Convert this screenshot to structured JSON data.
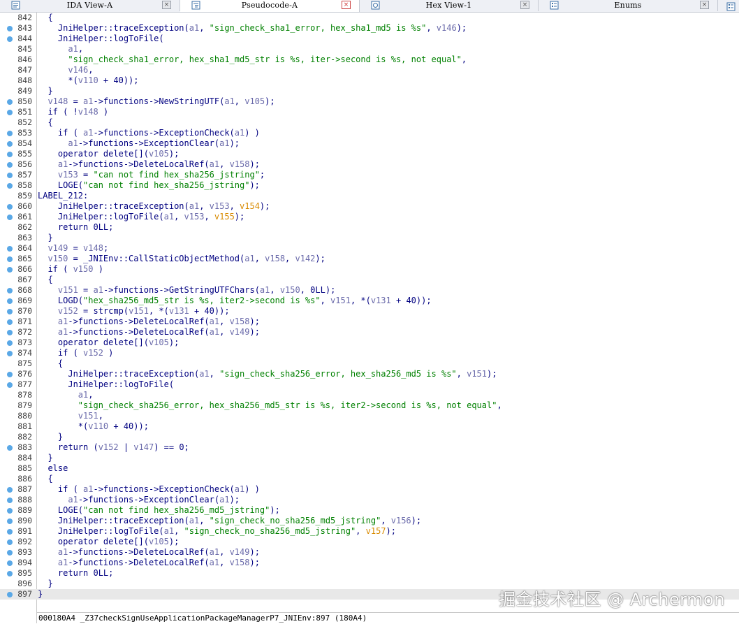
{
  "tabs": [
    {
      "label": "IDA View-A",
      "icon": "ida-view-icon",
      "active": false
    },
    {
      "label": "Pseudocode-A",
      "icon": "pseudocode-icon",
      "active": true
    },
    {
      "label": "Hex View-1",
      "icon": "hex-view-icon",
      "active": false
    },
    {
      "label": "Enums",
      "icon": "enums-icon",
      "active": false
    }
  ],
  "code_lines": [
    {
      "n": "842",
      "dot": false,
      "cur": false,
      "tokens": [
        [
          "  {",
          "t"
        ]
      ]
    },
    {
      "n": "843",
      "dot": true,
      "cur": false,
      "tokens": [
        [
          "    JniHelper::traceException(",
          "t"
        ],
        [
          "a1",
          "v"
        ],
        [
          ", ",
          "t"
        ],
        [
          "\"sign_check_sha1_error, hex_sha1_md5 is %s\"",
          "s"
        ],
        [
          ", ",
          "t"
        ],
        [
          "v146",
          "v"
        ],
        [
          ");",
          "t"
        ]
      ]
    },
    {
      "n": "844",
      "dot": true,
      "cur": false,
      "tokens": [
        [
          "    JniHelper::logToFile(",
          "t"
        ]
      ]
    },
    {
      "n": "845",
      "dot": false,
      "cur": false,
      "tokens": [
        [
          "      ",
          "t"
        ],
        [
          "a1",
          "v"
        ],
        [
          ",",
          "t"
        ]
      ]
    },
    {
      "n": "846",
      "dot": false,
      "cur": false,
      "tokens": [
        [
          "      ",
          "t"
        ],
        [
          "\"sign_check_sha1_error, hex_sha1_md5_str is %s, iter->second is %s, not equal\"",
          "s"
        ],
        [
          ",",
          "t"
        ]
      ]
    },
    {
      "n": "847",
      "dot": false,
      "cur": false,
      "tokens": [
        [
          "      ",
          "t"
        ],
        [
          "v146",
          "v"
        ],
        [
          ",",
          "t"
        ]
      ]
    },
    {
      "n": "848",
      "dot": false,
      "cur": false,
      "tokens": [
        [
          "      *(",
          "t"
        ],
        [
          "v110",
          "v"
        ],
        [
          " + 40));",
          "t"
        ]
      ]
    },
    {
      "n": "849",
      "dot": false,
      "cur": false,
      "tokens": [
        [
          "  }",
          "t"
        ]
      ]
    },
    {
      "n": "850",
      "dot": true,
      "cur": false,
      "tokens": [
        [
          "  ",
          "t"
        ],
        [
          "v148",
          "v"
        ],
        [
          " = ",
          "t"
        ],
        [
          "a1",
          "v"
        ],
        [
          "->functions->NewStringUTF(",
          "t"
        ],
        [
          "a1",
          "v"
        ],
        [
          ", ",
          "t"
        ],
        [
          "v105",
          "v"
        ],
        [
          ");",
          "t"
        ]
      ]
    },
    {
      "n": "851",
      "dot": true,
      "cur": false,
      "tokens": [
        [
          "  if ( !",
          "t"
        ],
        [
          "v148",
          "v"
        ],
        [
          " )",
          "t"
        ]
      ]
    },
    {
      "n": "852",
      "dot": false,
      "cur": false,
      "tokens": [
        [
          "  {",
          "t"
        ]
      ]
    },
    {
      "n": "853",
      "dot": true,
      "cur": false,
      "tokens": [
        [
          "    if ( ",
          "t"
        ],
        [
          "a1",
          "v"
        ],
        [
          "->functions->ExceptionCheck(",
          "t"
        ],
        [
          "a1",
          "v"
        ],
        [
          ") )",
          "t"
        ]
      ]
    },
    {
      "n": "854",
      "dot": true,
      "cur": false,
      "tokens": [
        [
          "      ",
          "t"
        ],
        [
          "a1",
          "v"
        ],
        [
          "->functions->ExceptionClear(",
          "t"
        ],
        [
          "a1",
          "v"
        ],
        [
          ");",
          "t"
        ]
      ]
    },
    {
      "n": "855",
      "dot": true,
      "cur": false,
      "tokens": [
        [
          "    operator delete[](",
          "t"
        ],
        [
          "v105",
          "v"
        ],
        [
          ");",
          "t"
        ]
      ]
    },
    {
      "n": "856",
      "dot": true,
      "cur": false,
      "tokens": [
        [
          "    ",
          "t"
        ],
        [
          "a1",
          "v"
        ],
        [
          "->functions->DeleteLocalRef(",
          "t"
        ],
        [
          "a1",
          "v"
        ],
        [
          ", ",
          "t"
        ],
        [
          "v158",
          "v"
        ],
        [
          ");",
          "t"
        ]
      ]
    },
    {
      "n": "857",
      "dot": true,
      "cur": false,
      "tokens": [
        [
          "    ",
          "t"
        ],
        [
          "v153",
          "v"
        ],
        [
          " = ",
          "t"
        ],
        [
          "\"can not find hex_sha256_jstring\"",
          "s"
        ],
        [
          ";",
          "t"
        ]
      ]
    },
    {
      "n": "858",
      "dot": true,
      "cur": false,
      "tokens": [
        [
          "    LOGE(",
          "t"
        ],
        [
          "\"can not find hex_sha256_jstring\"",
          "s"
        ],
        [
          ");",
          "t"
        ]
      ]
    },
    {
      "n": "859",
      "dot": false,
      "cur": false,
      "tokens": [
        [
          "LABEL_212:",
          "t"
        ]
      ]
    },
    {
      "n": "860",
      "dot": true,
      "cur": false,
      "tokens": [
        [
          "    JniHelper::traceException(",
          "t"
        ],
        [
          "a1",
          "v"
        ],
        [
          ", ",
          "t"
        ],
        [
          "v153",
          "v"
        ],
        [
          ", ",
          "t"
        ],
        [
          "v154",
          "o"
        ],
        [
          ");",
          "t"
        ]
      ]
    },
    {
      "n": "861",
      "dot": true,
      "cur": false,
      "tokens": [
        [
          "    JniHelper::logToFile(",
          "t"
        ],
        [
          "a1",
          "v"
        ],
        [
          ", ",
          "t"
        ],
        [
          "v153",
          "v"
        ],
        [
          ", ",
          "t"
        ],
        [
          "v155",
          "o"
        ],
        [
          ");",
          "t"
        ]
      ]
    },
    {
      "n": "862",
      "dot": false,
      "cur": false,
      "tokens": [
        [
          "    return 0LL;",
          "t"
        ]
      ]
    },
    {
      "n": "863",
      "dot": false,
      "cur": false,
      "tokens": [
        [
          "  }",
          "t"
        ]
      ]
    },
    {
      "n": "864",
      "dot": true,
      "cur": false,
      "tokens": [
        [
          "  ",
          "t"
        ],
        [
          "v149",
          "v"
        ],
        [
          " = ",
          "t"
        ],
        [
          "v148",
          "v"
        ],
        [
          ";",
          "t"
        ]
      ]
    },
    {
      "n": "865",
      "dot": true,
      "cur": false,
      "tokens": [
        [
          "  ",
          "t"
        ],
        [
          "v150",
          "v"
        ],
        [
          " = _JNIEnv::CallStaticObjectMethod(",
          "t"
        ],
        [
          "a1",
          "v"
        ],
        [
          ", ",
          "t"
        ],
        [
          "v158",
          "v"
        ],
        [
          ", ",
          "t"
        ],
        [
          "v142",
          "v"
        ],
        [
          ");",
          "t"
        ]
      ]
    },
    {
      "n": "866",
      "dot": true,
      "cur": false,
      "tokens": [
        [
          "  if ( ",
          "t"
        ],
        [
          "v150",
          "v"
        ],
        [
          " )",
          "t"
        ]
      ]
    },
    {
      "n": "867",
      "dot": false,
      "cur": false,
      "tokens": [
        [
          "  {",
          "t"
        ]
      ]
    },
    {
      "n": "868",
      "dot": true,
      "cur": false,
      "tokens": [
        [
          "    ",
          "t"
        ],
        [
          "v151",
          "v"
        ],
        [
          " = ",
          "t"
        ],
        [
          "a1",
          "v"
        ],
        [
          "->functions->GetStringUTFChars(",
          "t"
        ],
        [
          "a1",
          "v"
        ],
        [
          ", ",
          "t"
        ],
        [
          "v150",
          "v"
        ],
        [
          ", 0LL);",
          "t"
        ]
      ]
    },
    {
      "n": "869",
      "dot": true,
      "cur": false,
      "tokens": [
        [
          "    LOGD(",
          "t"
        ],
        [
          "\"hex_sha256_md5_str is %s, iter2->second is %s\"",
          "s"
        ],
        [
          ", ",
          "t"
        ],
        [
          "v151",
          "v"
        ],
        [
          ", *(",
          "t"
        ],
        [
          "v131",
          "v"
        ],
        [
          " + 40));",
          "t"
        ]
      ]
    },
    {
      "n": "870",
      "dot": true,
      "cur": false,
      "tokens": [
        [
          "    ",
          "t"
        ],
        [
          "v152",
          "v"
        ],
        [
          " = strcmp(",
          "t"
        ],
        [
          "v151",
          "v"
        ],
        [
          ", *(",
          "t"
        ],
        [
          "v131",
          "v"
        ],
        [
          " + 40));",
          "t"
        ]
      ]
    },
    {
      "n": "871",
      "dot": true,
      "cur": false,
      "tokens": [
        [
          "    ",
          "t"
        ],
        [
          "a1",
          "v"
        ],
        [
          "->functions->DeleteLocalRef(",
          "t"
        ],
        [
          "a1",
          "v"
        ],
        [
          ", ",
          "t"
        ],
        [
          "v158",
          "v"
        ],
        [
          ");",
          "t"
        ]
      ]
    },
    {
      "n": "872",
      "dot": true,
      "cur": false,
      "tokens": [
        [
          "    ",
          "t"
        ],
        [
          "a1",
          "v"
        ],
        [
          "->functions->DeleteLocalRef(",
          "t"
        ],
        [
          "a1",
          "v"
        ],
        [
          ", ",
          "t"
        ],
        [
          "v149",
          "v"
        ],
        [
          ");",
          "t"
        ]
      ]
    },
    {
      "n": "873",
      "dot": true,
      "cur": false,
      "tokens": [
        [
          "    operator delete[](",
          "t"
        ],
        [
          "v105",
          "v"
        ],
        [
          ");",
          "t"
        ]
      ]
    },
    {
      "n": "874",
      "dot": true,
      "cur": false,
      "tokens": [
        [
          "    if ( ",
          "t"
        ],
        [
          "v152",
          "v"
        ],
        [
          " )",
          "t"
        ]
      ]
    },
    {
      "n": "875",
      "dot": false,
      "cur": false,
      "tokens": [
        [
          "    {",
          "t"
        ]
      ]
    },
    {
      "n": "876",
      "dot": true,
      "cur": false,
      "tokens": [
        [
          "      JniHelper::traceException(",
          "t"
        ],
        [
          "a1",
          "v"
        ],
        [
          ", ",
          "t"
        ],
        [
          "\"sign_check_sha256_error, hex_sha256_md5 is %s\"",
          "s"
        ],
        [
          ", ",
          "t"
        ],
        [
          "v151",
          "v"
        ],
        [
          ");",
          "t"
        ]
      ]
    },
    {
      "n": "877",
      "dot": true,
      "cur": false,
      "tokens": [
        [
          "      JniHelper::logToFile(",
          "t"
        ]
      ]
    },
    {
      "n": "878",
      "dot": false,
      "cur": false,
      "tokens": [
        [
          "        ",
          "t"
        ],
        [
          "a1",
          "v"
        ],
        [
          ",",
          "t"
        ]
      ]
    },
    {
      "n": "879",
      "dot": false,
      "cur": false,
      "tokens": [
        [
          "        ",
          "t"
        ],
        [
          "\"sign_check_sha256_error, hex_sha256_md5_str is %s, iter2->second is %s, not equal\"",
          "s"
        ],
        [
          ",",
          "t"
        ]
      ]
    },
    {
      "n": "880",
      "dot": false,
      "cur": false,
      "tokens": [
        [
          "        ",
          "t"
        ],
        [
          "v151",
          "v"
        ],
        [
          ",",
          "t"
        ]
      ]
    },
    {
      "n": "881",
      "dot": false,
      "cur": false,
      "tokens": [
        [
          "        *(",
          "t"
        ],
        [
          "v110",
          "v"
        ],
        [
          " + 40));",
          "t"
        ]
      ]
    },
    {
      "n": "882",
      "dot": false,
      "cur": false,
      "tokens": [
        [
          "    }",
          "t"
        ]
      ]
    },
    {
      "n": "883",
      "dot": true,
      "cur": false,
      "tokens": [
        [
          "    return (",
          "t"
        ],
        [
          "v152",
          "v"
        ],
        [
          " | ",
          "t"
        ],
        [
          "v147",
          "v"
        ],
        [
          ") == 0;",
          "t"
        ]
      ]
    },
    {
      "n": "884",
      "dot": false,
      "cur": false,
      "tokens": [
        [
          "  }",
          "t"
        ]
      ]
    },
    {
      "n": "885",
      "dot": false,
      "cur": false,
      "tokens": [
        [
          "  else",
          "t"
        ]
      ]
    },
    {
      "n": "886",
      "dot": false,
      "cur": false,
      "tokens": [
        [
          "  {",
          "t"
        ]
      ]
    },
    {
      "n": "887",
      "dot": true,
      "cur": false,
      "tokens": [
        [
          "    if ( ",
          "t"
        ],
        [
          "a1",
          "v"
        ],
        [
          "->functions->ExceptionCheck(",
          "t"
        ],
        [
          "a1",
          "v"
        ],
        [
          ") )",
          "t"
        ]
      ]
    },
    {
      "n": "888",
      "dot": true,
      "cur": false,
      "tokens": [
        [
          "      ",
          "t"
        ],
        [
          "a1",
          "v"
        ],
        [
          "->functions->ExceptionClear(",
          "t"
        ],
        [
          "a1",
          "v"
        ],
        [
          ");",
          "t"
        ]
      ]
    },
    {
      "n": "889",
      "dot": true,
      "cur": false,
      "tokens": [
        [
          "    LOGE(",
          "t"
        ],
        [
          "\"can not find hex_sha256_md5_jstring\"",
          "s"
        ],
        [
          ");",
          "t"
        ]
      ]
    },
    {
      "n": "890",
      "dot": true,
      "cur": false,
      "tokens": [
        [
          "    JniHelper::traceException(",
          "t"
        ],
        [
          "a1",
          "v"
        ],
        [
          ", ",
          "t"
        ],
        [
          "\"sign_check_no_sha256_md5_jstring\"",
          "s"
        ],
        [
          ", ",
          "t"
        ],
        [
          "v156",
          "v"
        ],
        [
          ");",
          "t"
        ]
      ]
    },
    {
      "n": "891",
      "dot": true,
      "cur": false,
      "tokens": [
        [
          "    JniHelper::logToFile(",
          "t"
        ],
        [
          "a1",
          "v"
        ],
        [
          ", ",
          "t"
        ],
        [
          "\"sign_check_no_sha256_md5_jstring\"",
          "s"
        ],
        [
          ", ",
          "t"
        ],
        [
          "v157",
          "o"
        ],
        [
          ");",
          "t"
        ]
      ]
    },
    {
      "n": "892",
      "dot": true,
      "cur": false,
      "tokens": [
        [
          "    operator delete[](",
          "t"
        ],
        [
          "v105",
          "v"
        ],
        [
          ");",
          "t"
        ]
      ]
    },
    {
      "n": "893",
      "dot": true,
      "cur": false,
      "tokens": [
        [
          "    ",
          "t"
        ],
        [
          "a1",
          "v"
        ],
        [
          "->functions->DeleteLocalRef(",
          "t"
        ],
        [
          "a1",
          "v"
        ],
        [
          ", ",
          "t"
        ],
        [
          "v149",
          "v"
        ],
        [
          ");",
          "t"
        ]
      ]
    },
    {
      "n": "894",
      "dot": true,
      "cur": false,
      "tokens": [
        [
          "    ",
          "t"
        ],
        [
          "a1",
          "v"
        ],
        [
          "->functions->DeleteLocalRef(",
          "t"
        ],
        [
          "a1",
          "v"
        ],
        [
          ", ",
          "t"
        ],
        [
          "v158",
          "v"
        ],
        [
          ");",
          "t"
        ]
      ]
    },
    {
      "n": "895",
      "dot": true,
      "cur": false,
      "tokens": [
        [
          "    return 0LL;",
          "t"
        ]
      ]
    },
    {
      "n": "896",
      "dot": false,
      "cur": false,
      "tokens": [
        [
          "  }",
          "t"
        ]
      ]
    },
    {
      "n": "897",
      "dot": true,
      "cur": true,
      "tokens": [
        [
          "}",
          "t"
        ]
      ]
    }
  ],
  "status_bar": {
    "text": "000180A4 _Z37checkSignUseApplicationPackageManagerP7_JNIEnv:897 (180A4)"
  },
  "watermark": "掘金技术社区 @ Archermon",
  "colors": {
    "code_text": "#000080",
    "string": "#008000",
    "variable": "#6a6aaa",
    "undefined_var": "#d88a00",
    "breakpoint_dot": "#5aa8e6",
    "current_line_bg": "#e8e8e8",
    "tab_bar_bg": "#eef0f5"
  }
}
